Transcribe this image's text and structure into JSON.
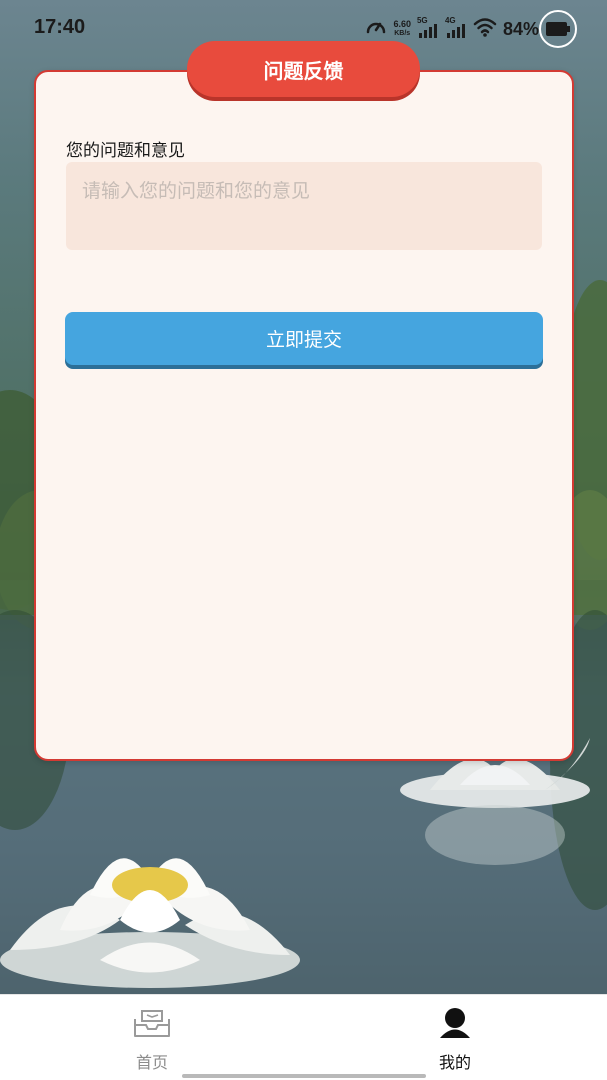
{
  "status_bar": {
    "time": "17:40",
    "net_speed_value": "6.60",
    "net_speed_unit": "KB/s",
    "signal1_label": "5G",
    "signal2_label": "4G",
    "battery": "84%",
    "icons": [
      "speedometer-icon",
      "signal-icon",
      "signal-icon",
      "wifi-icon",
      "battery-icon"
    ]
  },
  "header": {
    "title": "问题反馈"
  },
  "form": {
    "label": "您的问题和意见",
    "placeholder": "请输入您的问题和您的意见",
    "value": "",
    "submit_label": "立即提交"
  },
  "bottom_nav": {
    "items": [
      {
        "label": "首页",
        "icon": "home-icon",
        "active": false
      },
      {
        "label": "我的",
        "icon": "profile-icon",
        "active": true
      }
    ]
  },
  "colors": {
    "accent_red": "#e84b3d",
    "button_blue": "#45a5df",
    "card_bg": "#fdf5f0",
    "input_bg": "#f8e6dc"
  }
}
